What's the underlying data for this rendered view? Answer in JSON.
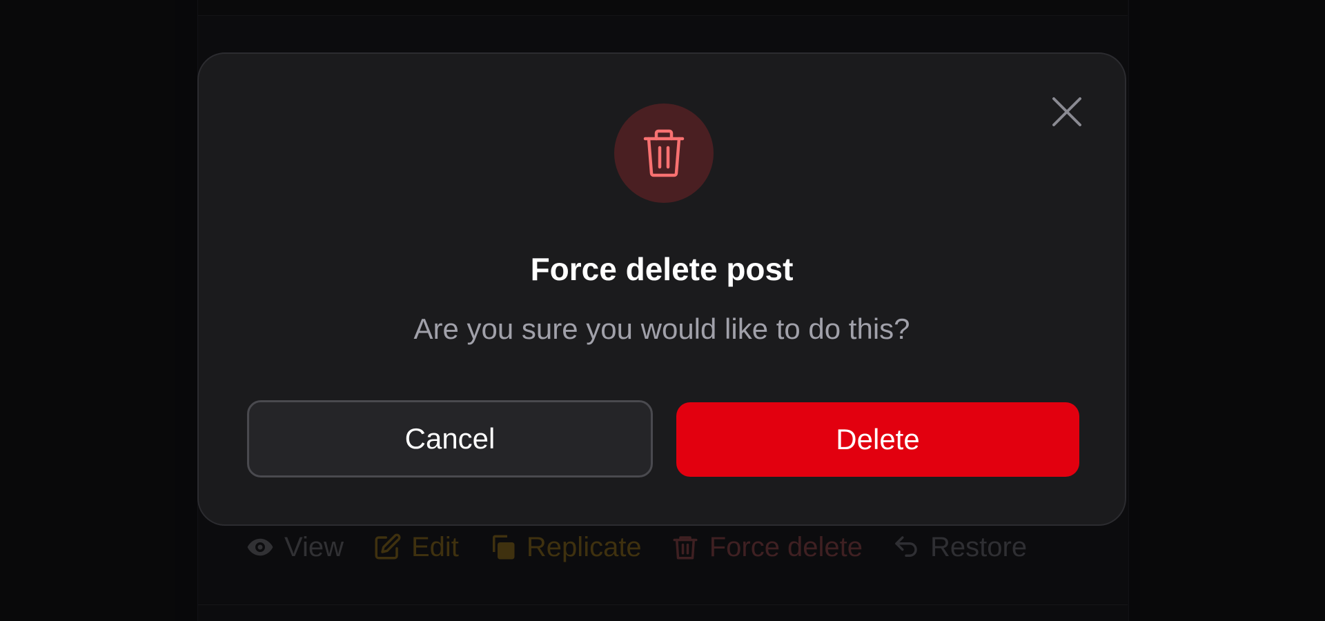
{
  "background": {
    "actions": [
      {
        "label": "View",
        "icon": "eye-icon"
      },
      {
        "label": "Edit",
        "icon": "pencil-square-icon"
      },
      {
        "label": "Replicate",
        "icon": "duplicate-icon"
      },
      {
        "label": "Force delete",
        "icon": "trash-icon"
      },
      {
        "label": "Restore",
        "icon": "undo-arrow-icon"
      }
    ]
  },
  "modal": {
    "icon": "trash-icon",
    "title": "Force delete post",
    "description": "Are you sure you would like to do this?",
    "cancel_label": "Cancel",
    "confirm_label": "Delete",
    "close_icon": "close-icon"
  },
  "colors": {
    "danger": "#e2000f",
    "danger_icon": "#f87171",
    "danger_circle": "#4a1f22",
    "modal_bg": "#1b1b1d",
    "warning_muted": "#4a3a12"
  }
}
